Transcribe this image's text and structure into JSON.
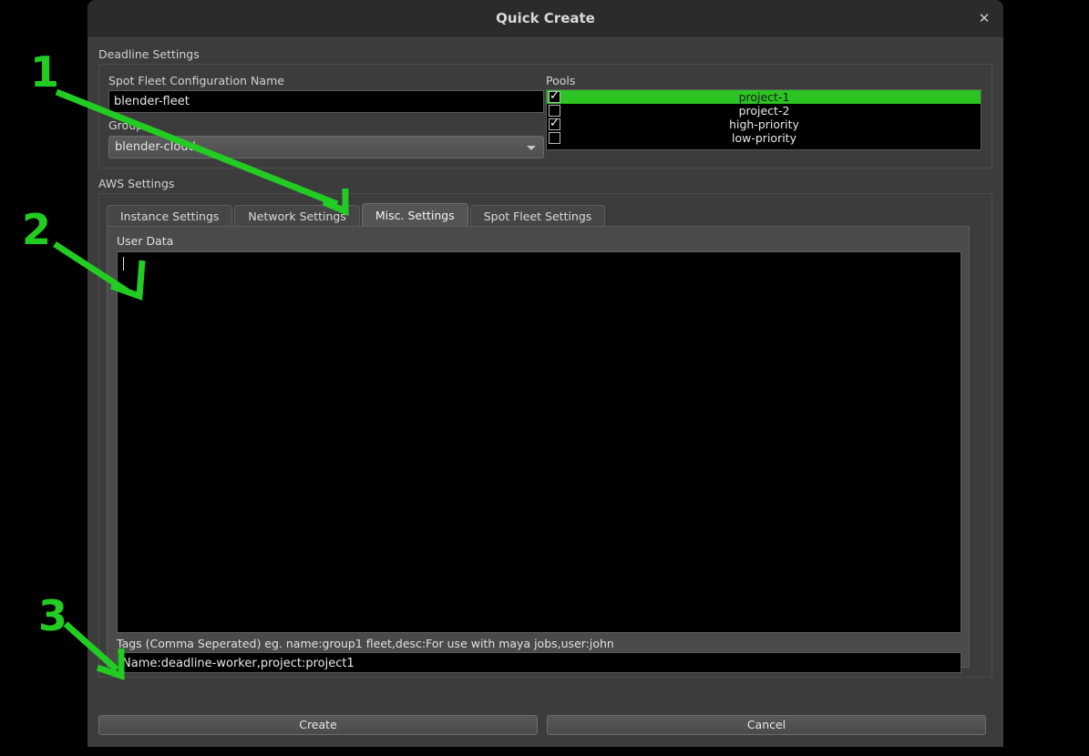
{
  "window": {
    "title": "Quick Create",
    "close_icon": "close-icon"
  },
  "deadline_settings": {
    "group_title": "Deadline Settings",
    "spot_fleet_name_label": "Spot Fleet Configuration Name",
    "spot_fleet_name_value": "blender-fleet",
    "group_label": "Group",
    "group_value": "blender-cloud",
    "group_dropdown_icon": "chevron-down-icon",
    "pools_label": "Pools",
    "pools": [
      {
        "label": "project-1",
        "checked": true,
        "selected": true
      },
      {
        "label": "project-2",
        "checked": false,
        "selected": false
      },
      {
        "label": "high-priority",
        "checked": true,
        "selected": false
      },
      {
        "label": "low-priority",
        "checked": false,
        "selected": false
      }
    ]
  },
  "aws_settings": {
    "group_title": "AWS Settings",
    "tabs": [
      {
        "label": "Instance Settings",
        "active": false
      },
      {
        "label": "Network Settings",
        "active": false
      },
      {
        "label": "Misc. Settings",
        "active": true
      },
      {
        "label": "Spot Fleet Settings",
        "active": false
      }
    ],
    "user_data_label": "User Data",
    "user_data_value": "",
    "tags_label": "Tags (Comma Seperated) eg. name:group1 fleet,desc:For use with maya jobs,user:john",
    "tags_value": "Name:deadline-worker,project:project1"
  },
  "footer": {
    "create_label": "Create",
    "cancel_label": "Cancel"
  },
  "annotations": {
    "accent_color": "#22cc22",
    "markers": [
      {
        "number": "1",
        "target": "misc-settings-tab"
      },
      {
        "number": "2",
        "target": "user-data-textarea"
      },
      {
        "number": "3",
        "target": "tags-input"
      }
    ]
  },
  "colors": {
    "window_background": "#3c3c3c",
    "titlebar": "#2b2b2b",
    "field_background": "#000000",
    "selection_green": "#2cc423",
    "desktop": "#000000"
  }
}
